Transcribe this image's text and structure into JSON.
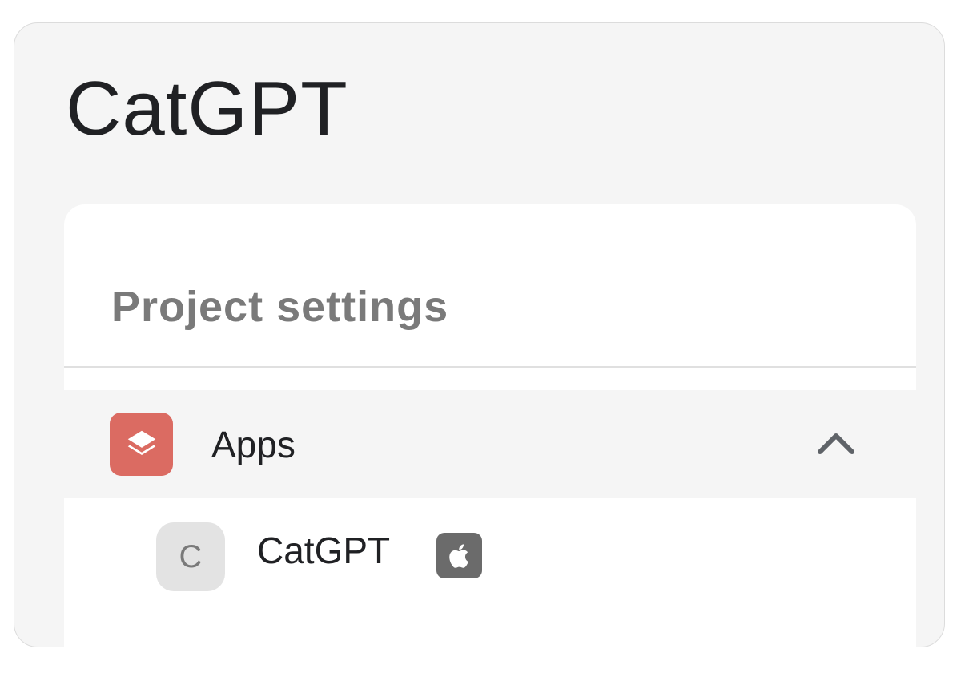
{
  "project": {
    "title": "CatGPT"
  },
  "settings_card": {
    "title": "Project settings"
  },
  "sections": {
    "apps": {
      "label": "Apps",
      "icon": "layers-icon",
      "icon_color": "#db6b62",
      "expanded": true
    }
  },
  "apps": [
    {
      "avatar_letter": "C",
      "name": "CatGPT",
      "platform_icon": "apple-icon",
      "platform_color": "#6b6b6b"
    }
  ]
}
